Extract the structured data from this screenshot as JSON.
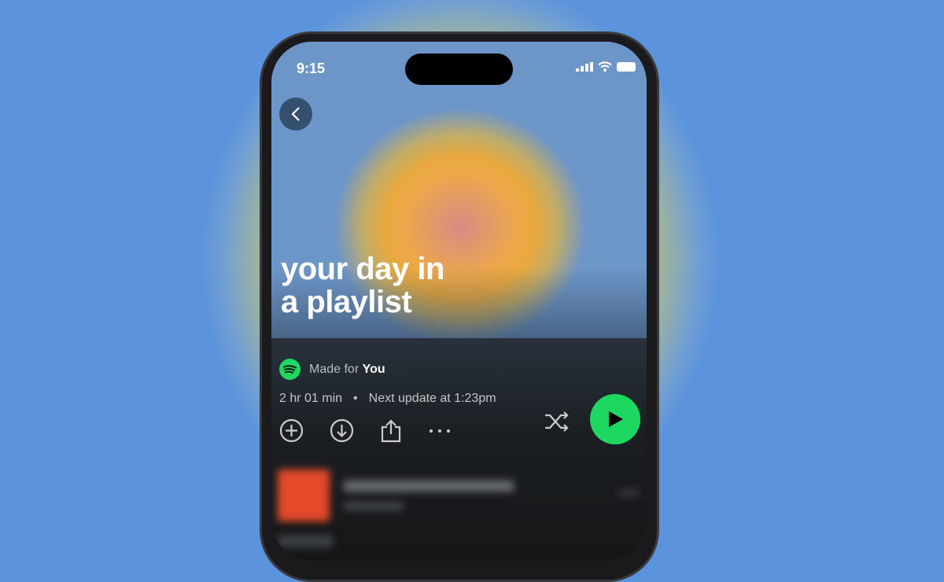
{
  "status_bar": {
    "time": "9:15",
    "icons": [
      "signal-icon",
      "wifi-icon",
      "battery-icon"
    ]
  },
  "playlist": {
    "title_line1": "your day in",
    "title_line2": "a playlist",
    "made_for_prefix": "Made for",
    "made_for_name": "You",
    "duration": "2 hr 01 min",
    "separator": "•",
    "next_update": "Next update at 1:23pm"
  },
  "colors": {
    "accent": "#1ed760",
    "background": "#5b93dc",
    "glow": "#f2b43c",
    "song_art": "#e44a2a"
  }
}
